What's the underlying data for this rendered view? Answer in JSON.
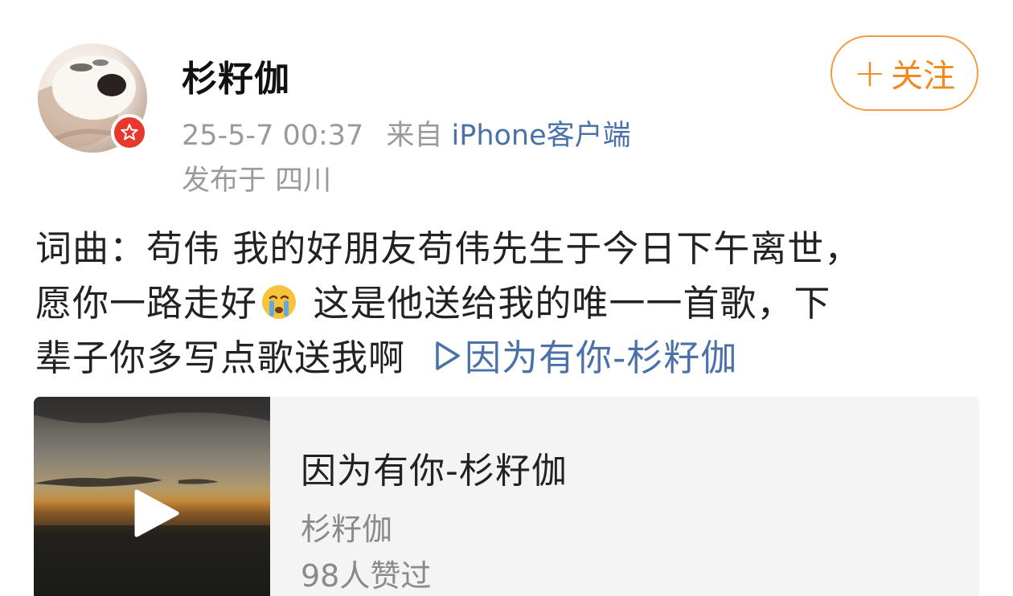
{
  "post": {
    "author": "杉籽伽",
    "timestamp": "25-5-7 00:37",
    "source_prefix": "来自",
    "source": "iPhone客户端",
    "location": "发布于 四川",
    "follow_label": "关注",
    "content": {
      "line1": "词曲：苟伟  我的好朋友苟伟先生于今日下午离世，",
      "line2_before_emoji": "愿你一路走好",
      "line2_after_emoji": " 这是他送给我的唯一一首歌，下",
      "line3": "辈子你多写点歌送我啊",
      "music_link": "因为有你-杉籽伽"
    },
    "card": {
      "title": "因为有你-杉籽伽",
      "artist": "杉籽伽",
      "likes": "98人赞过"
    }
  },
  "icons": {
    "avatar": "avatar-dog-photo",
    "verified": "verified-badge-icon",
    "emoji": "crying-emoji-icon",
    "play": "play-icon",
    "music_link": "play-triangle-icon"
  },
  "colors": {
    "link": "#4a72a8",
    "follow": "#f08a1f",
    "verified": "#e8372c",
    "meta": "#9a9a9a"
  }
}
